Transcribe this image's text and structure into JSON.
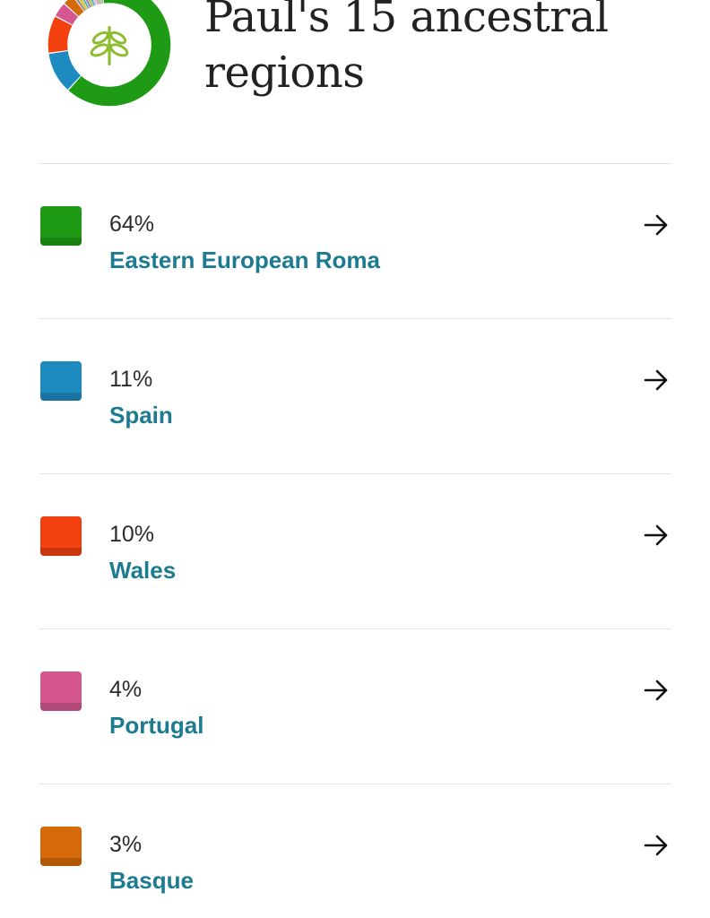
{
  "header": {
    "title": "Paul's 15 ancestral regions"
  },
  "icons": {
    "logo": "ancestry-leaf-icon",
    "row_arrow": "arrow-right-icon"
  },
  "regions": [
    {
      "percent": "64%",
      "name": "Eastern European Roma",
      "value": 64,
      "color": "#1e9a14"
    },
    {
      "percent": "11%",
      "name": "Spain",
      "value": 11,
      "color": "#1e8bc0"
    },
    {
      "percent": "10%",
      "name": "Wales",
      "value": 10,
      "color": "#f2400f"
    },
    {
      "percent": "4%",
      "name": "Portugal",
      "value": 4,
      "color": "#d6578f"
    },
    {
      "percent": "3%",
      "name": "Basque",
      "value": 3,
      "color": "#d56a0a"
    }
  ],
  "colors": {
    "accent_text": "#1c7b91",
    "logo_leaf": "#8dbd2f",
    "divider": "#e3e3e3"
  }
}
